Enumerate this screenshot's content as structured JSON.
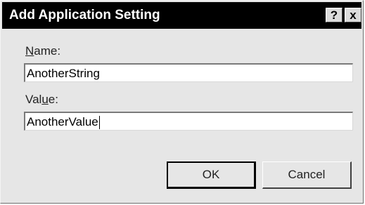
{
  "window": {
    "title": "Add Application Setting",
    "help_label": "?",
    "close_label": "x"
  },
  "form": {
    "name_label_prefix": "",
    "name_label_accel": "N",
    "name_label_rest": "ame:",
    "name_value": "AnotherString",
    "value_label_prefix": "Val",
    "value_label_accel": "u",
    "value_label_rest": "e:",
    "value_value": "AnotherValue"
  },
  "buttons": {
    "ok_label": "OK",
    "cancel_label": "Cancel"
  }
}
